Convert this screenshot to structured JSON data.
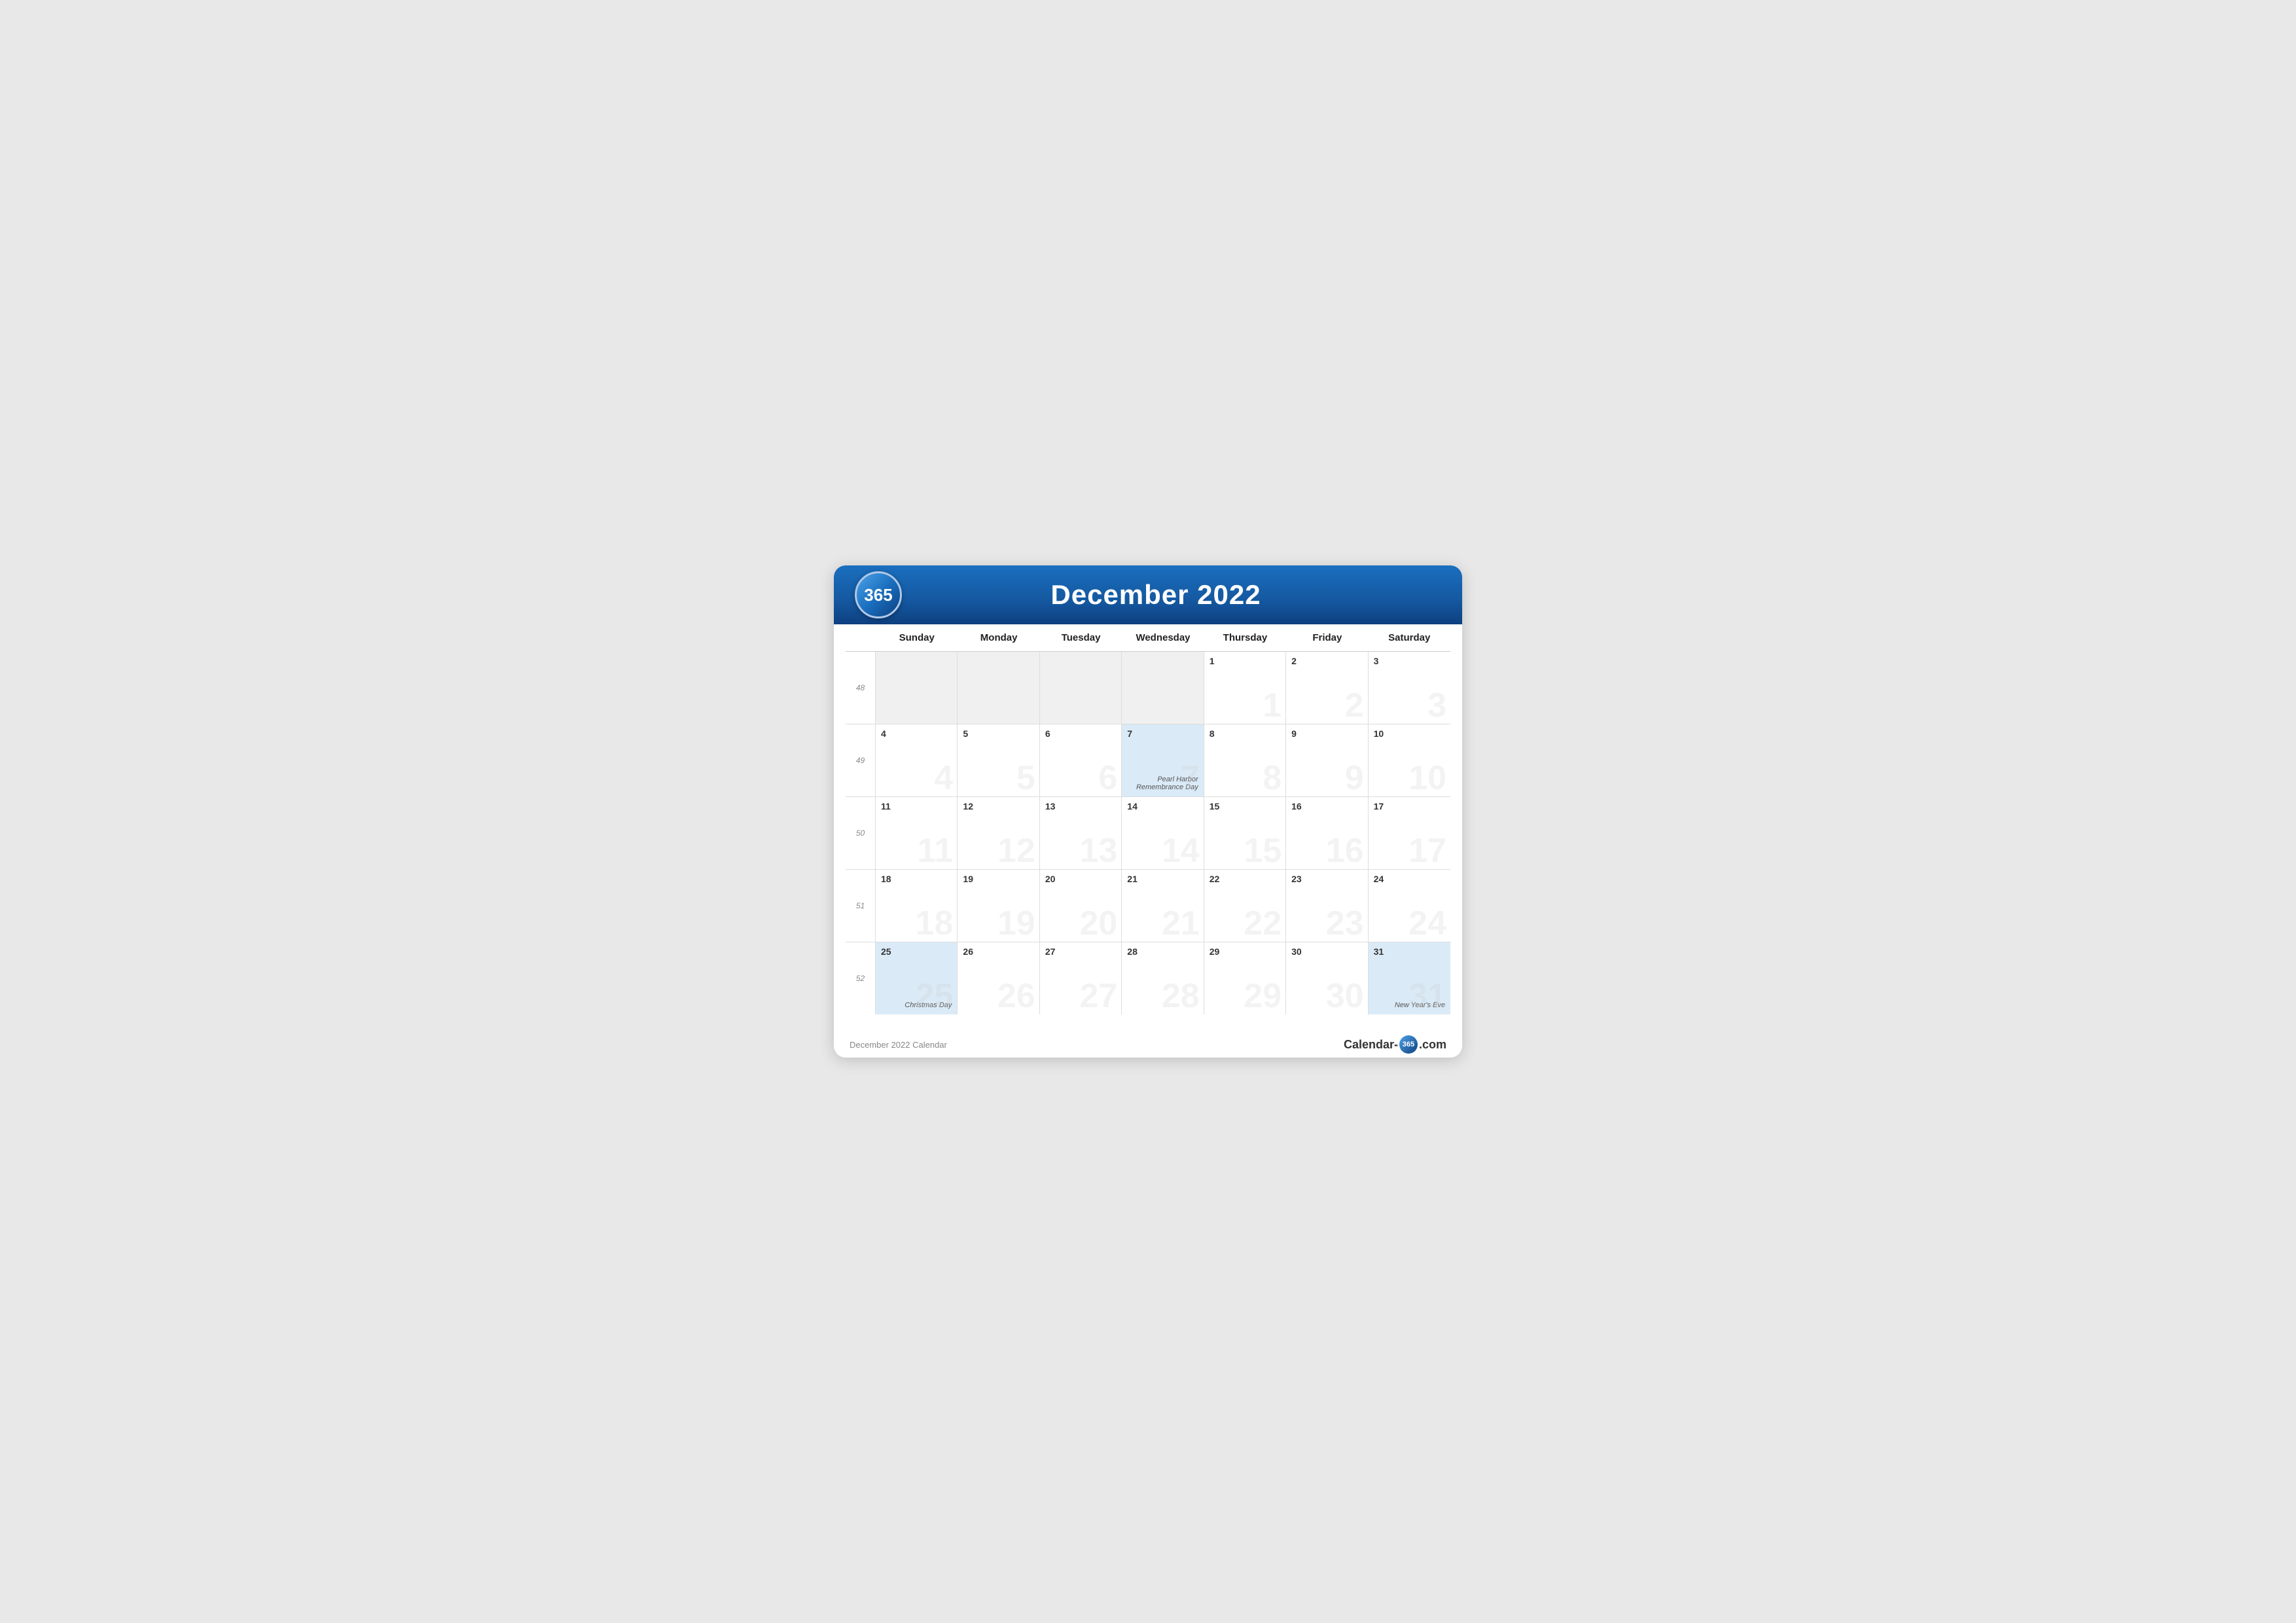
{
  "header": {
    "logo": "365",
    "title": "December 2022"
  },
  "days_of_week": [
    "Sunday",
    "Monday",
    "Tuesday",
    "Wednesday",
    "Thursday",
    "Friday",
    "Saturday"
  ],
  "weeks": [
    {
      "week_num": "48",
      "days": [
        {
          "date": "",
          "empty": true
        },
        {
          "date": "",
          "empty": true
        },
        {
          "date": "",
          "empty": true
        },
        {
          "date": "",
          "empty": true
        },
        {
          "date": "1",
          "empty": false,
          "highlight": false
        },
        {
          "date": "2",
          "empty": false,
          "highlight": false
        },
        {
          "date": "3",
          "empty": false,
          "highlight": false
        }
      ]
    },
    {
      "week_num": "49",
      "days": [
        {
          "date": "4",
          "empty": false,
          "highlight": false
        },
        {
          "date": "5",
          "empty": false,
          "highlight": false
        },
        {
          "date": "6",
          "empty": false,
          "highlight": false
        },
        {
          "date": "7",
          "empty": false,
          "highlight": true,
          "holiday": "Pearl Harbor Remembrance Day"
        },
        {
          "date": "8",
          "empty": false,
          "highlight": false
        },
        {
          "date": "9",
          "empty": false,
          "highlight": false
        },
        {
          "date": "10",
          "empty": false,
          "highlight": false
        }
      ]
    },
    {
      "week_num": "50",
      "days": [
        {
          "date": "11",
          "empty": false,
          "highlight": false
        },
        {
          "date": "12",
          "empty": false,
          "highlight": false
        },
        {
          "date": "13",
          "empty": false,
          "highlight": false
        },
        {
          "date": "14",
          "empty": false,
          "highlight": false
        },
        {
          "date": "15",
          "empty": false,
          "highlight": false
        },
        {
          "date": "16",
          "empty": false,
          "highlight": false
        },
        {
          "date": "17",
          "empty": false,
          "highlight": false
        }
      ]
    },
    {
      "week_num": "51",
      "days": [
        {
          "date": "18",
          "empty": false,
          "highlight": false
        },
        {
          "date": "19",
          "empty": false,
          "highlight": false
        },
        {
          "date": "20",
          "empty": false,
          "highlight": false
        },
        {
          "date": "21",
          "empty": false,
          "highlight": false
        },
        {
          "date": "22",
          "empty": false,
          "highlight": false
        },
        {
          "date": "23",
          "empty": false,
          "highlight": false
        },
        {
          "date": "24",
          "empty": false,
          "highlight": false
        }
      ]
    },
    {
      "week_num": "52",
      "days": [
        {
          "date": "25",
          "empty": false,
          "highlight": true,
          "holiday": "Christmas Day"
        },
        {
          "date": "26",
          "empty": false,
          "highlight": false
        },
        {
          "date": "27",
          "empty": false,
          "highlight": false
        },
        {
          "date": "28",
          "empty": false,
          "highlight": false
        },
        {
          "date": "29",
          "empty": false,
          "highlight": false
        },
        {
          "date": "30",
          "empty": false,
          "highlight": false
        },
        {
          "date": "31",
          "empty": false,
          "highlight": true,
          "holiday": "New Year's Eve"
        }
      ]
    }
  ],
  "footer": {
    "caption": "December 2022 Calendar",
    "brand_text_before": "Calendar-",
    "brand_365": "365",
    "brand_text_after": ".com"
  }
}
